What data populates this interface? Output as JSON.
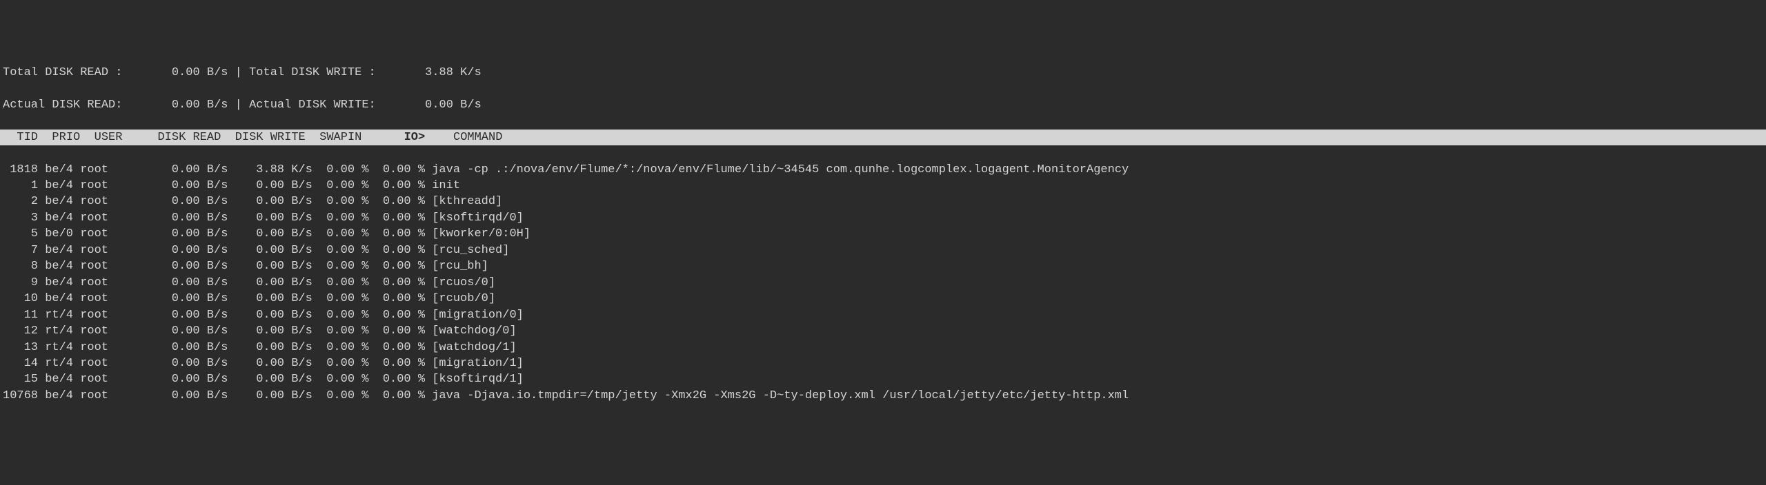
{
  "summary": {
    "total_read_label": "Total DISK READ :",
    "total_read_value": "0.00 B/s",
    "total_write_label": "Total DISK WRITE :",
    "total_write_value": "3.88 K/s",
    "actual_read_label": "Actual DISK READ:",
    "actual_read_value": "0.00 B/s",
    "actual_write_label": "Actual DISK WRITE:",
    "actual_write_value": "0.00 B/s"
  },
  "header": {
    "tid": "TID",
    "prio": "PRIO",
    "user": "USER",
    "disk_read": "DISK READ",
    "disk_write": "DISK WRITE",
    "swapin": "SWAPIN",
    "io": "IO>",
    "command": "COMMAND"
  },
  "processes": [
    {
      "tid": "1818",
      "prio": "be/4",
      "user": "root",
      "read": "0.00 B/s",
      "write": "3.88 K/s",
      "swapin": "0.00 %",
      "io": "0.00 %",
      "cmd": "java -cp .:/nova/env/Flume/*:/nova/env/Flume/lib/~34545 com.qunhe.logcomplex.logagent.MonitorAgency"
    },
    {
      "tid": "1",
      "prio": "be/4",
      "user": "root",
      "read": "0.00 B/s",
      "write": "0.00 B/s",
      "swapin": "0.00 %",
      "io": "0.00 %",
      "cmd": "init"
    },
    {
      "tid": "2",
      "prio": "be/4",
      "user": "root",
      "read": "0.00 B/s",
      "write": "0.00 B/s",
      "swapin": "0.00 %",
      "io": "0.00 %",
      "cmd": "[kthreadd]"
    },
    {
      "tid": "3",
      "prio": "be/4",
      "user": "root",
      "read": "0.00 B/s",
      "write": "0.00 B/s",
      "swapin": "0.00 %",
      "io": "0.00 %",
      "cmd": "[ksoftirqd/0]"
    },
    {
      "tid": "5",
      "prio": "be/0",
      "user": "root",
      "read": "0.00 B/s",
      "write": "0.00 B/s",
      "swapin": "0.00 %",
      "io": "0.00 %",
      "cmd": "[kworker/0:0H]"
    },
    {
      "tid": "7",
      "prio": "be/4",
      "user": "root",
      "read": "0.00 B/s",
      "write": "0.00 B/s",
      "swapin": "0.00 %",
      "io": "0.00 %",
      "cmd": "[rcu_sched]"
    },
    {
      "tid": "8",
      "prio": "be/4",
      "user": "root",
      "read": "0.00 B/s",
      "write": "0.00 B/s",
      "swapin": "0.00 %",
      "io": "0.00 %",
      "cmd": "[rcu_bh]"
    },
    {
      "tid": "9",
      "prio": "be/4",
      "user": "root",
      "read": "0.00 B/s",
      "write": "0.00 B/s",
      "swapin": "0.00 %",
      "io": "0.00 %",
      "cmd": "[rcuos/0]"
    },
    {
      "tid": "10",
      "prio": "be/4",
      "user": "root",
      "read": "0.00 B/s",
      "write": "0.00 B/s",
      "swapin": "0.00 %",
      "io": "0.00 %",
      "cmd": "[rcuob/0]"
    },
    {
      "tid": "11",
      "prio": "rt/4",
      "user": "root",
      "read": "0.00 B/s",
      "write": "0.00 B/s",
      "swapin": "0.00 %",
      "io": "0.00 %",
      "cmd": "[migration/0]"
    },
    {
      "tid": "12",
      "prio": "rt/4",
      "user": "root",
      "read": "0.00 B/s",
      "write": "0.00 B/s",
      "swapin": "0.00 %",
      "io": "0.00 %",
      "cmd": "[watchdog/0]"
    },
    {
      "tid": "13",
      "prio": "rt/4",
      "user": "root",
      "read": "0.00 B/s",
      "write": "0.00 B/s",
      "swapin": "0.00 %",
      "io": "0.00 %",
      "cmd": "[watchdog/1]"
    },
    {
      "tid": "14",
      "prio": "rt/4",
      "user": "root",
      "read": "0.00 B/s",
      "write": "0.00 B/s",
      "swapin": "0.00 %",
      "io": "0.00 %",
      "cmd": "[migration/1]"
    },
    {
      "tid": "15",
      "prio": "be/4",
      "user": "root",
      "read": "0.00 B/s",
      "write": "0.00 B/s",
      "swapin": "0.00 %",
      "io": "0.00 %",
      "cmd": "[ksoftirqd/1]"
    },
    {
      "tid": "10768",
      "prio": "be/4",
      "user": "root",
      "read": "0.00 B/s",
      "write": "0.00 B/s",
      "swapin": "0.00 %",
      "io": "0.00 %",
      "cmd": "java -Djava.io.tmpdir=/tmp/jetty -Xmx2G -Xms2G -D~ty-deploy.xml /usr/local/jetty/etc/jetty-http.xml"
    }
  ]
}
